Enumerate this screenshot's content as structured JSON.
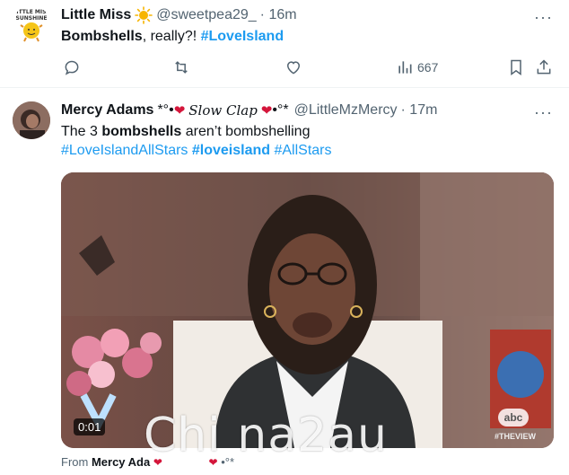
{
  "tweet1": {
    "author_name": "Little Miss",
    "handle": "@sweetpea29_",
    "time": "· 16m",
    "text_before": "Bombshells",
    "text_middle": ", really?! ",
    "hashtag": "#LoveIsland",
    "views": "667",
    "avatar_text": "LITTLE MISS SUNSHINE"
  },
  "tweet2": {
    "author_name": "Mercy Adams",
    "name_deco_left": "*°•",
    "name_script": "Slow Clap",
    "name_deco_right": "•°*",
    "handle": "@LittleMzMercy",
    "time": "· 17m",
    "line1_prefix": "The 3 ",
    "line1_bold": "bombshells",
    "line1_suffix": " aren’t bombshelling",
    "hashtag1": "#LoveIslandAllStars",
    "hashtag2": "#loveisland",
    "hashtag3": "#AllStars",
    "video_time": "0:01",
    "network_logo": "abc",
    "show_tag": "#THEVIEW",
    "from_label": "From ",
    "from_name": "Mercy Ada",
    "from_tail": "•°*"
  },
  "watermark": "Chi na2au",
  "icons": {
    "reply": "reply-icon",
    "retweet": "retweet-icon",
    "like": "heart-icon",
    "views": "views-icon",
    "bookmark": "bookmark-icon",
    "share": "share-icon",
    "more": "more-icon"
  }
}
